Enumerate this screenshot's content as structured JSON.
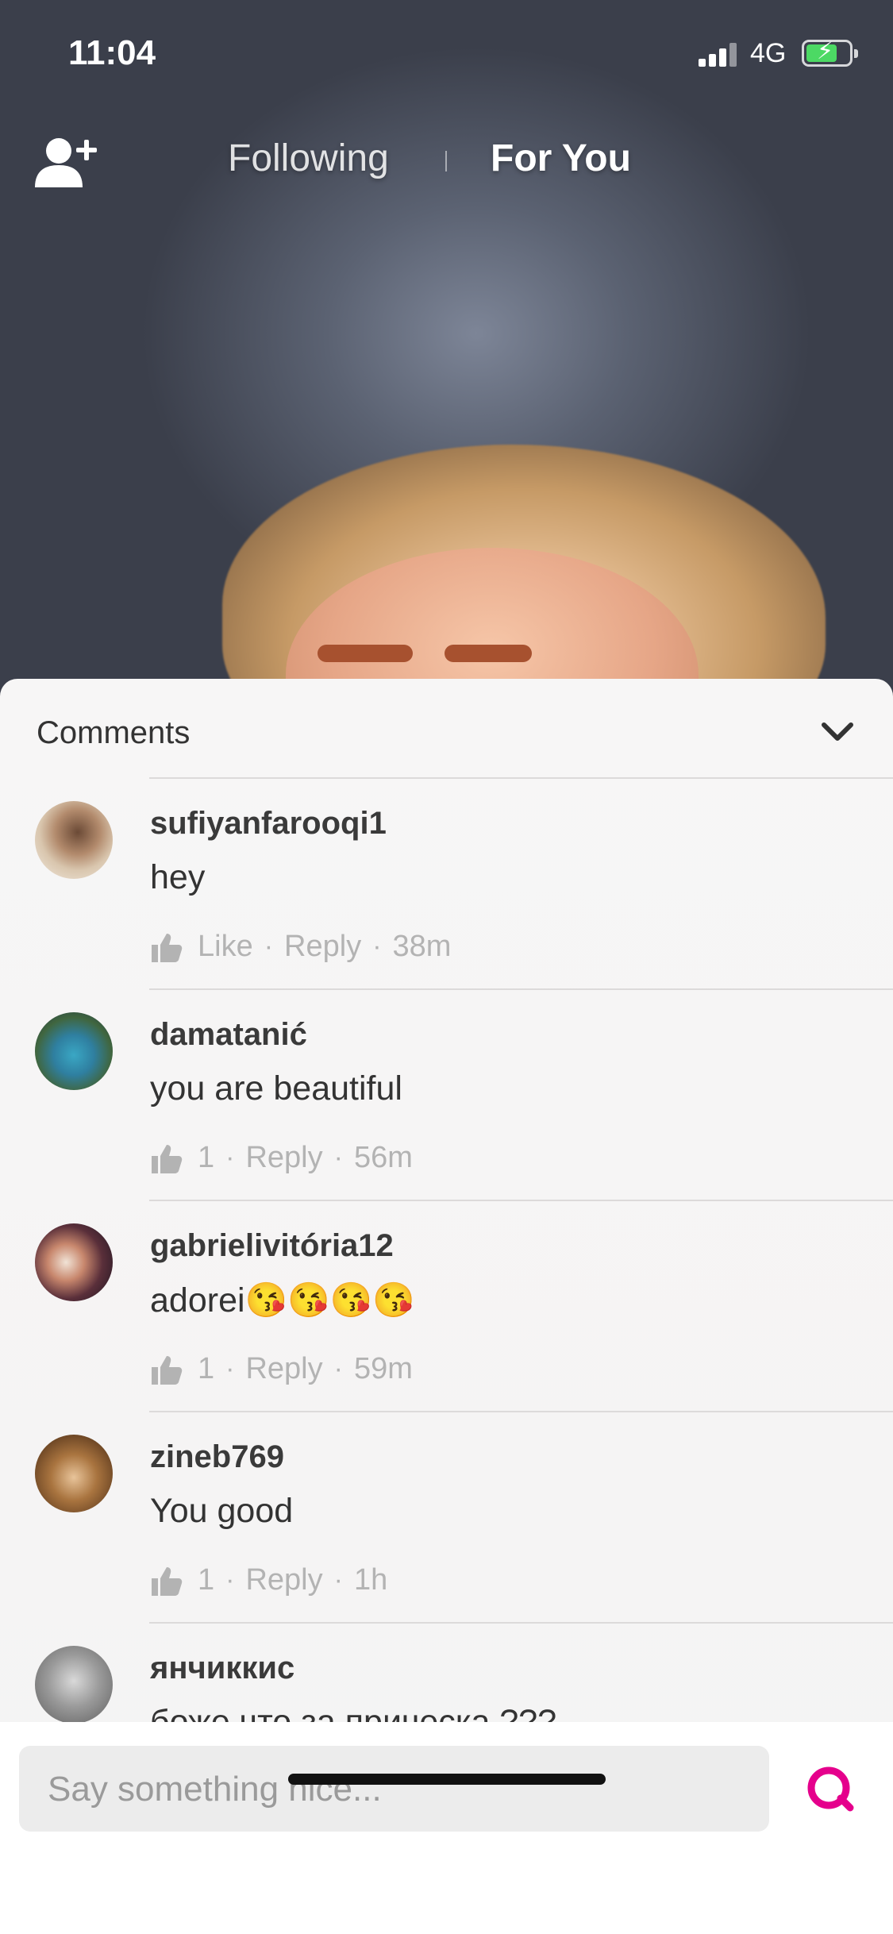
{
  "status_bar": {
    "time": "11:04",
    "network": "4G"
  },
  "top_nav": {
    "tabs": [
      {
        "label": "Following",
        "active": false
      },
      {
        "label": "For You",
        "active": true
      }
    ]
  },
  "comments_sheet": {
    "title": "Comments",
    "items": [
      {
        "username": "sufiyanfarooqi1",
        "text": "hey",
        "likes": "Like",
        "reply": "Reply",
        "time": "38m"
      },
      {
        "username": "damatanić",
        "text": "you are beautiful",
        "likes": "1",
        "reply": "Reply",
        "time": "56m"
      },
      {
        "username": "gabrielivitória12",
        "text": "adorei😘😘😘😘",
        "likes": "1",
        "reply": "Reply",
        "time": "59m"
      },
      {
        "username": "zineb769",
        "text": "You good",
        "likes": "1",
        "reply": "Reply",
        "time": "1h"
      },
      {
        "username": "янчиккис",
        "text": "боже что за прическа ???",
        "likes": "",
        "reply": "",
        "time": ""
      }
    ]
  },
  "input": {
    "placeholder": "Say something nice..."
  },
  "colors": {
    "accent": "#e5008c",
    "battery": "#4cd964"
  }
}
